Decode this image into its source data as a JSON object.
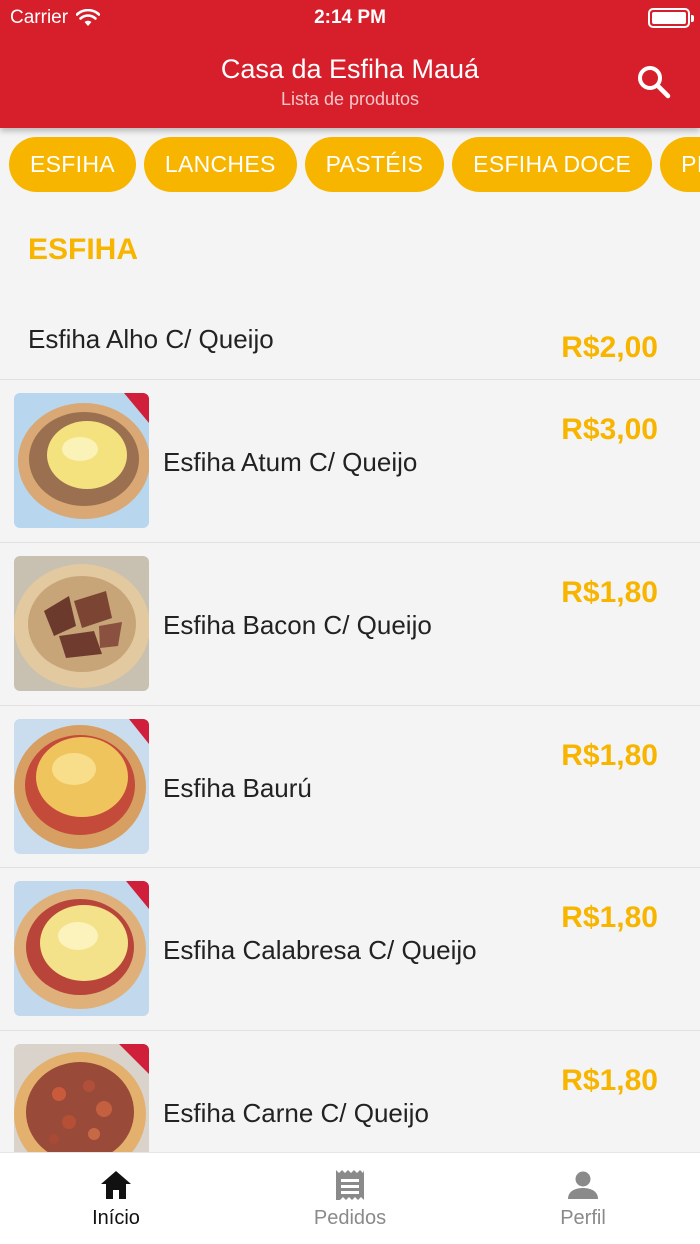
{
  "status_bar": {
    "carrier": "Carrier",
    "time": "2:14 PM"
  },
  "header": {
    "title": "Casa da Esfiha Mauá",
    "subtitle": "Lista de produtos"
  },
  "categories": [
    "ESFIHA",
    "LANCHES",
    "PASTÉIS",
    "ESFIHA DOCE",
    "PIZZA"
  ],
  "section": {
    "title": "ESFIHA"
  },
  "products": [
    {
      "name": "Esfiha Alho C/ Queijo",
      "price": "R$2,00",
      "image": false
    },
    {
      "name": "Esfiha Atum C/ Queijo",
      "price": "R$3,00",
      "image": "cheese"
    },
    {
      "name": "Esfiha Bacon C/ Queijo",
      "price": "R$1,80",
      "image": "bacon"
    },
    {
      "name": "Esfiha Baurú",
      "price": "R$1,80",
      "image": "bauru"
    },
    {
      "name": "Esfiha Calabresa C/ Queijo",
      "price": "R$1,80",
      "image": "calabresa"
    },
    {
      "name": "Esfiha Carne C/ Queijo",
      "price": "R$1,80",
      "image": "carne"
    }
  ],
  "tabbar": {
    "inicio": "Início",
    "pedidos": "Pedidos",
    "perfil": "Perfil"
  },
  "colors": {
    "header": "#d71f2b",
    "accent": "#f7b500"
  }
}
